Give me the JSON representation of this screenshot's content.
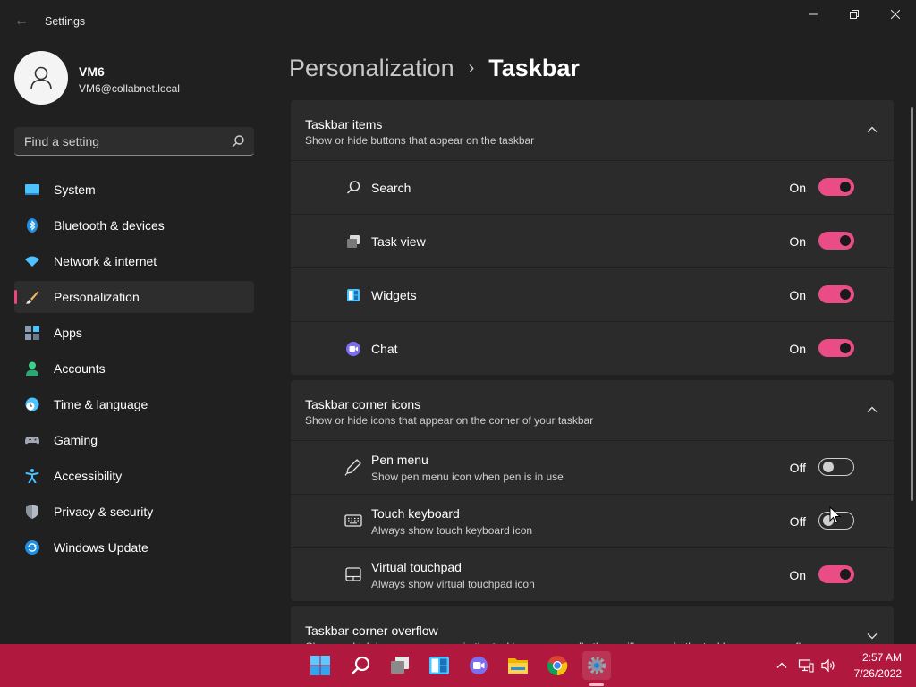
{
  "window": {
    "app_title": "Settings",
    "back_glyph": "←",
    "controls": [
      "minimize-icon",
      "maximize-icon",
      "close-icon"
    ]
  },
  "user": {
    "name": "VM6",
    "email": "VM6@collabnet.local"
  },
  "search": {
    "placeholder": "Find a setting"
  },
  "sidebar": {
    "items": [
      {
        "label": "System",
        "icon": "monitor-icon"
      },
      {
        "label": "Bluetooth & devices",
        "icon": "bluetooth-icon"
      },
      {
        "label": "Network & internet",
        "icon": "wifi-icon"
      },
      {
        "label": "Personalization",
        "icon": "brush-icon",
        "selected": true
      },
      {
        "label": "Apps",
        "icon": "apps-icon"
      },
      {
        "label": "Accounts",
        "icon": "person-icon"
      },
      {
        "label": "Time & language",
        "icon": "globe-clock-icon"
      },
      {
        "label": "Gaming",
        "icon": "gamepad-icon"
      },
      {
        "label": "Accessibility",
        "icon": "accessibility-icon"
      },
      {
        "label": "Privacy & security",
        "icon": "shield-icon"
      },
      {
        "label": "Windows Update",
        "icon": "update-icon"
      }
    ]
  },
  "breadcrumb": {
    "parent": "Personalization",
    "separator": "›",
    "current": "Taskbar"
  },
  "sections": {
    "taskbar_items": {
      "title": "Taskbar items",
      "subtitle": "Show or hide buttons that appear on the taskbar",
      "expanded": true,
      "rows": [
        {
          "title": "Search",
          "state": "On",
          "on": true,
          "icon": "search-icon"
        },
        {
          "title": "Task view",
          "state": "On",
          "on": true,
          "icon": "task-view-icon"
        },
        {
          "title": "Widgets",
          "state": "On",
          "on": true,
          "icon": "widgets-icon"
        },
        {
          "title": "Chat",
          "state": "On",
          "on": true,
          "icon": "chat-icon"
        }
      ]
    },
    "corner_icons": {
      "title": "Taskbar corner icons",
      "subtitle": "Show or hide icons that appear on the corner of your taskbar",
      "expanded": true,
      "rows": [
        {
          "title": "Pen menu",
          "desc": "Show pen menu icon when pen is in use",
          "state": "Off",
          "on": false,
          "icon": "pen-icon"
        },
        {
          "title": "Touch keyboard",
          "desc": "Always show touch keyboard icon",
          "state": "Off",
          "on": false,
          "icon": "keyboard-icon"
        },
        {
          "title": "Virtual touchpad",
          "desc": "Always show virtual touchpad icon",
          "state": "On",
          "on": true,
          "icon": "touchpad-icon"
        }
      ]
    },
    "corner_overflow": {
      "title": "Taskbar corner overflow",
      "subtitle": "Choose which icons may appear in the taskbar corner – all others will appear in the taskbar corner overflow menu",
      "expanded": false
    }
  },
  "taskbar": {
    "apps": [
      "start-icon",
      "search-icon",
      "task-view-icon",
      "widgets-icon",
      "chat-icon",
      "file-explorer-icon",
      "chrome-icon",
      "settings-icon"
    ],
    "active_app": "settings-icon",
    "tray": [
      "chevron-up-icon",
      "network-icon",
      "volume-icon"
    ],
    "time": "2:57 AM",
    "date": "7/26/2022"
  },
  "colors": {
    "accent": "#ea4d85",
    "taskbar": "#b0183e",
    "background": "#202020",
    "card": "#2b2b2b"
  }
}
